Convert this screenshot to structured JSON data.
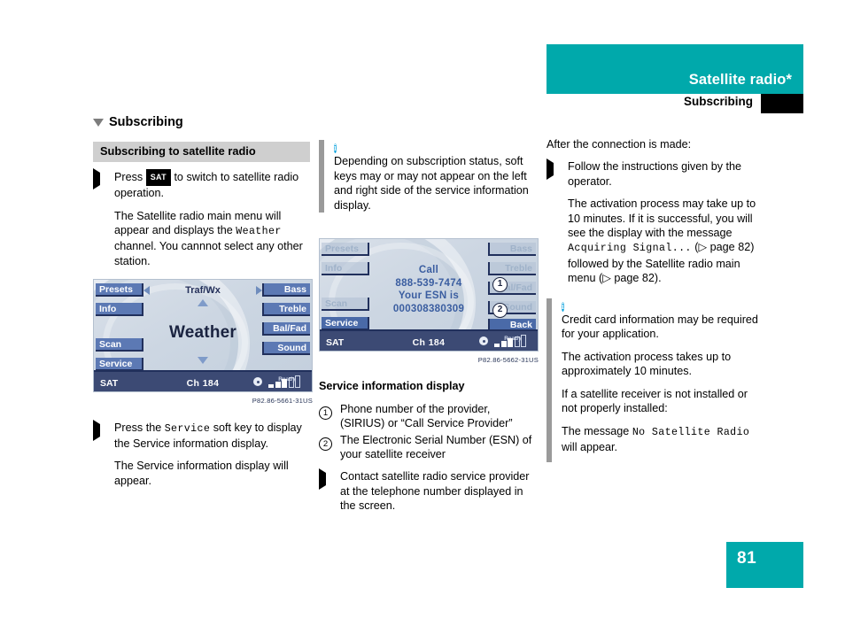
{
  "header": {
    "title": "Satellite radio*",
    "subtitle": "Subscribing",
    "accent_color": "#00a9ab"
  },
  "page_number": "81",
  "col1": {
    "section_heading": "Subscribing",
    "sub_heading": "Subscribing to satellite radio",
    "step1_pre": "Press",
    "step1_key": "SAT",
    "step1_post": "to switch to satellite radio operation.",
    "para1_a": "The Satellite radio main menu will appear and displays the",
    "para1_mono": "Weather",
    "para1_b": "channel. You cannnot select any other station.",
    "figure_caption": "P82.86-5661-31US",
    "step2_a": "Press the",
    "step2_mono": "Service",
    "step2_b": "soft key to display the Service information display.",
    "para2": "The Service information display will appear."
  },
  "col2": {
    "note": "Depending on subscription status, soft keys may or may not appear on the left and right side of the service information display.",
    "figure_caption": "P82.86-5662-31US",
    "sub_heading": "Service information display",
    "item1": "Phone number of the provider, (SIRIUS) or “Call Service Provider”",
    "item1_num": "1",
    "item2": "The Electronic Serial Number (ESN) of your satellite receiver",
    "item2_num": "2",
    "bullet": "Contact satellite radio service provider at the telephone number displayed in the screen."
  },
  "col3": {
    "lead": "After the connection is made:",
    "step1": "Follow the instructions given by the operator.",
    "para1_a": "The activation process may take up to 10 minutes. If it is successful, you will see the display with the message",
    "para1_mono": "Acquiring Signal...",
    "para1_b": "(▷ page 82) followed by the Satellite radio main menu (▷ page 82).",
    "note1": "Credit card information may be required for your application.",
    "note2": "The activation process takes up to approximately 10 minutes.",
    "note3": "If a satellite receiver is not installed or not properly installed:",
    "note4_a": "The message",
    "note4_mono": "No Satellite Radio",
    "note4_b": "will appear."
  },
  "display1": {
    "left_keys": [
      {
        "label": "Presets",
        "state": "off"
      },
      {
        "label": "Info",
        "state": "on"
      },
      {
        "label": "Scan",
        "state": "off"
      },
      {
        "label": "Service",
        "state": "on"
      }
    ],
    "right_keys": [
      {
        "label": "Bass",
        "state": "on"
      },
      {
        "label": "Treble",
        "state": "on"
      },
      {
        "label": "Bal/Fad",
        "state": "on"
      },
      {
        "label": "Sound",
        "state": "on"
      }
    ],
    "nav_label": "Traf/Wx",
    "station": "Weather",
    "status_source": "SAT",
    "status_channel": "Ch 184",
    "status_ready": "Ready",
    "signal_bars": [
      1,
      1,
      1,
      0,
      0
    ]
  },
  "display2": {
    "left_keys": [
      {
        "label": "Presets",
        "state": "off"
      },
      {
        "label": "Info",
        "state": "off"
      },
      {
        "label": "Scan",
        "state": "off"
      },
      {
        "label": "Service",
        "state": "hi"
      }
    ],
    "right_keys": [
      {
        "label": "Bass",
        "state": "off"
      },
      {
        "label": "Treble",
        "state": "off"
      },
      {
        "label": "Bal/Fad",
        "state": "off"
      },
      {
        "label": "Sound",
        "state": "off"
      },
      {
        "label": "Back",
        "state": "hi"
      }
    ],
    "line1": "Call",
    "line2": "888-539-7474",
    "line3": "Your ESN is",
    "line4": "000308380309",
    "callout1": "1",
    "callout2": "2",
    "status_source": "SAT",
    "status_channel": "Ch 184",
    "status_ready": "Ready",
    "signal_bars": [
      1,
      1,
      1,
      0,
      0
    ]
  }
}
